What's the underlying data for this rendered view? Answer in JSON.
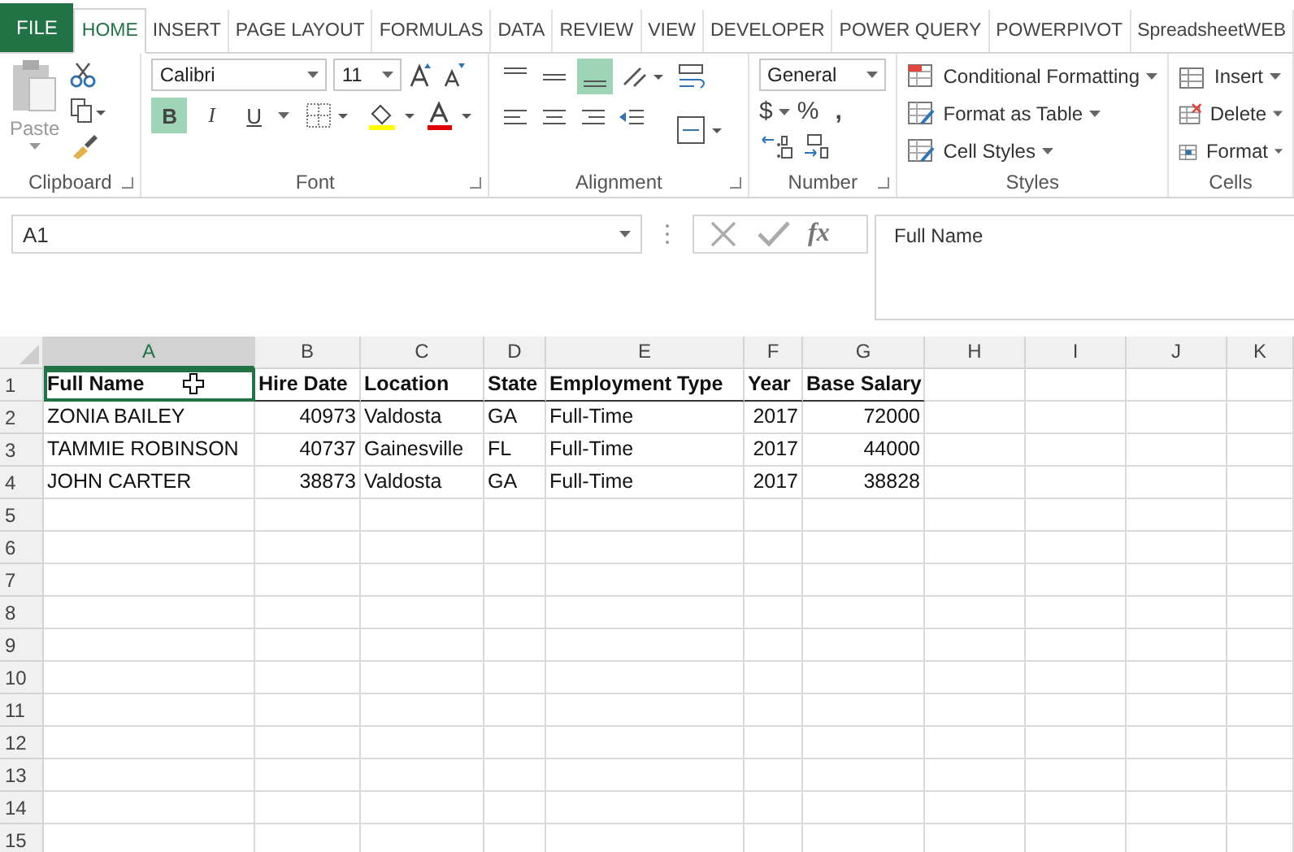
{
  "tabs": [
    {
      "label": "FILE",
      "kind": "file",
      "selected": false
    },
    {
      "label": "HOME",
      "kind": "tab",
      "selected": true
    },
    {
      "label": "INSERT",
      "kind": "tab",
      "selected": false
    },
    {
      "label": "PAGE LAYOUT",
      "kind": "tab",
      "selected": false
    },
    {
      "label": "FORMULAS",
      "kind": "tab",
      "selected": false
    },
    {
      "label": "DATA",
      "kind": "tab",
      "selected": false
    },
    {
      "label": "REVIEW",
      "kind": "tab",
      "selected": false
    },
    {
      "label": "VIEW",
      "kind": "tab",
      "selected": false
    },
    {
      "label": "DEVELOPER",
      "kind": "tab",
      "selected": false
    },
    {
      "label": "POWER QUERY",
      "kind": "tab",
      "selected": false
    },
    {
      "label": "POWERPIVOT",
      "kind": "tab",
      "selected": false
    },
    {
      "label": "SpreadsheetWEB",
      "kind": "tab",
      "selected": false
    }
  ],
  "ribbon": {
    "clipboard": {
      "label": "Clipboard",
      "paste": "Paste"
    },
    "font": {
      "label": "Font",
      "name": "Calibri",
      "size": "11",
      "bold": {
        "label": "B",
        "selected": true
      },
      "italic": {
        "label": "I",
        "selected": false
      },
      "underline": {
        "label": "U",
        "selected": false
      }
    },
    "alignment": {
      "label": "Alignment",
      "bottom_align_selected": true
    },
    "number": {
      "label": "Number",
      "format": "General",
      "currency": "$",
      "percent": "%",
      "comma": ","
    },
    "styles": {
      "label": "Styles",
      "items": [
        "Conditional Formatting",
        "Format as Table",
        "Cell Styles"
      ]
    },
    "cells": {
      "label": "Cells",
      "items": [
        "Insert",
        "Delete",
        "Format"
      ]
    }
  },
  "formula_bar": {
    "name_box": "A1",
    "formula": "Full Name",
    "fx": "fx"
  },
  "sheet": {
    "columns": [
      {
        "label": "A",
        "selected": true
      },
      {
        "label": "B",
        "selected": false
      },
      {
        "label": "C",
        "selected": false
      },
      {
        "label": "D",
        "selected": false
      },
      {
        "label": "E",
        "selected": false
      },
      {
        "label": "F",
        "selected": false
      },
      {
        "label": "G",
        "selected": false
      },
      {
        "label": "H",
        "selected": false
      },
      {
        "label": "I",
        "selected": false
      },
      {
        "label": "J",
        "selected": false
      },
      {
        "label": "K",
        "selected": false
      }
    ],
    "rows": [
      {
        "label": "1",
        "cells": [
          {
            "text": "Full Name",
            "bold": true,
            "selected": true
          },
          {
            "text": "Hire Date",
            "bold": true,
            "selected": false
          },
          {
            "text": "Location",
            "bold": true,
            "selected": false
          },
          {
            "text": "State",
            "bold": true,
            "selected": false
          },
          {
            "text": "Employment Type",
            "bold": true,
            "selected": false
          },
          {
            "text": "Year",
            "bold": true,
            "selected": false
          },
          {
            "text": "Base Salary",
            "bold": true,
            "selected": false
          }
        ]
      },
      {
        "label": "2",
        "cells": [
          {
            "text": "ZONIA BAILEY",
            "bold": false,
            "selected": false
          },
          {
            "text": "40973",
            "bold": false,
            "selected": false
          },
          {
            "text": "Valdosta",
            "bold": false,
            "selected": false
          },
          {
            "text": "GA",
            "bold": false,
            "selected": false
          },
          {
            "text": "Full-Time",
            "bold": false,
            "selected": false
          },
          {
            "text": "2017",
            "bold": false,
            "selected": false
          },
          {
            "text": "72000",
            "bold": false,
            "selected": false
          }
        ]
      },
      {
        "label": "3",
        "cells": [
          {
            "text": "TAMMIE ROBINSON",
            "bold": false,
            "selected": false
          },
          {
            "text": "40737",
            "bold": false,
            "selected": false
          },
          {
            "text": "Gainesville",
            "bold": false,
            "selected": false
          },
          {
            "text": "FL",
            "bold": false,
            "selected": false
          },
          {
            "text": "Full-Time",
            "bold": false,
            "selected": false
          },
          {
            "text": "2017",
            "bold": false,
            "selected": false
          },
          {
            "text": "44000",
            "bold": false,
            "selected": false
          }
        ]
      },
      {
        "label": "4",
        "cells": [
          {
            "text": "JOHN CARTER",
            "bold": false,
            "selected": false
          },
          {
            "text": "38873",
            "bold": false,
            "selected": false
          },
          {
            "text": "Valdosta",
            "bold": false,
            "selected": false
          },
          {
            "text": "GA",
            "bold": false,
            "selected": false
          },
          {
            "text": "Full-Time",
            "bold": false,
            "selected": false
          },
          {
            "text": "2017",
            "bold": false,
            "selected": false
          },
          {
            "text": "38828",
            "bold": false,
            "selected": false
          }
        ]
      },
      {
        "label": "5"
      },
      {
        "label": "6"
      },
      {
        "label": "7"
      },
      {
        "label": "8"
      },
      {
        "label": "9"
      },
      {
        "label": "10"
      },
      {
        "label": "11"
      },
      {
        "label": "12"
      },
      {
        "label": "13"
      },
      {
        "label": "14"
      },
      {
        "label": "15"
      }
    ]
  }
}
